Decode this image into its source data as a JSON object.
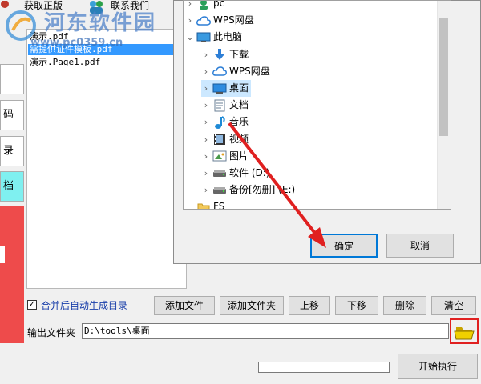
{
  "top_menu": {
    "item_left": "获取正版",
    "item_right": "联系我们"
  },
  "watermark": {
    "title": "河东软件园",
    "url": "www.pc0359.cn"
  },
  "left_tabs": {
    "tab1": "",
    "tab2": "码",
    "tab3": "录",
    "tab4": "档",
    "red_mark": ""
  },
  "file_list": {
    "items": [
      "演示.pdf",
      "需提供证件模板.pdf",
      "演示.Page1.pdf"
    ],
    "selected_index": 1
  },
  "tree": {
    "items": [
      {
        "label": "pc",
        "icon": "pc-user-icon",
        "chevron": "›",
        "level": 1
      },
      {
        "label": "WPS网盘",
        "icon": "cloud-icon",
        "chevron": "›",
        "level": 1
      },
      {
        "label": "此电脑",
        "icon": "computer-icon",
        "chevron": "⌄",
        "level": 1
      },
      {
        "label": "下载",
        "icon": "download-arrow-icon",
        "chevron": "›",
        "level": 2
      },
      {
        "label": "WPS网盘",
        "icon": "cloud-icon",
        "chevron": "›",
        "level": 2
      },
      {
        "label": "桌面",
        "icon": "desktop-icon",
        "chevron": "›",
        "level": 2
      },
      {
        "label": "文档",
        "icon": "document-icon",
        "chevron": "›",
        "level": 2
      },
      {
        "label": "音乐",
        "icon": "music-note-icon",
        "chevron": "›",
        "level": 2
      },
      {
        "label": "视频",
        "icon": "film-icon",
        "chevron": "›",
        "level": 2
      },
      {
        "label": "图片",
        "icon": "picture-icon",
        "chevron": "›",
        "level": 2
      },
      {
        "label": "软件 (D:)",
        "icon": "drive-icon",
        "chevron": "›",
        "level": 2
      },
      {
        "label": "备份[勿删] (E:)",
        "icon": "drive-icon",
        "chevron": "›",
        "level": 2
      },
      {
        "label": "FS",
        "icon": "folder-icon",
        "chevron": "",
        "level": 1
      }
    ],
    "selected_index": 5
  },
  "dialog": {
    "ok_label": "确定",
    "cancel_label": "取消"
  },
  "toolbar": {
    "auto_toc_label": "合并后自动生成目录",
    "auto_toc_checked": true,
    "add_file": "添加文件",
    "add_folder": "添加文件夹",
    "move_up": "上移",
    "move_down": "下移",
    "delete": "删除",
    "clear": "清空"
  },
  "output": {
    "label": "输出文件夹",
    "path": "D:\\tools\\桌面"
  },
  "progress": {
    "value": 0
  },
  "execute": {
    "label": "开始执行"
  },
  "colors": {
    "accent": "#0078d7",
    "selection": "#3399ff",
    "annotation_red": "#e02020",
    "watermark_blue": "#4a7fc8"
  }
}
